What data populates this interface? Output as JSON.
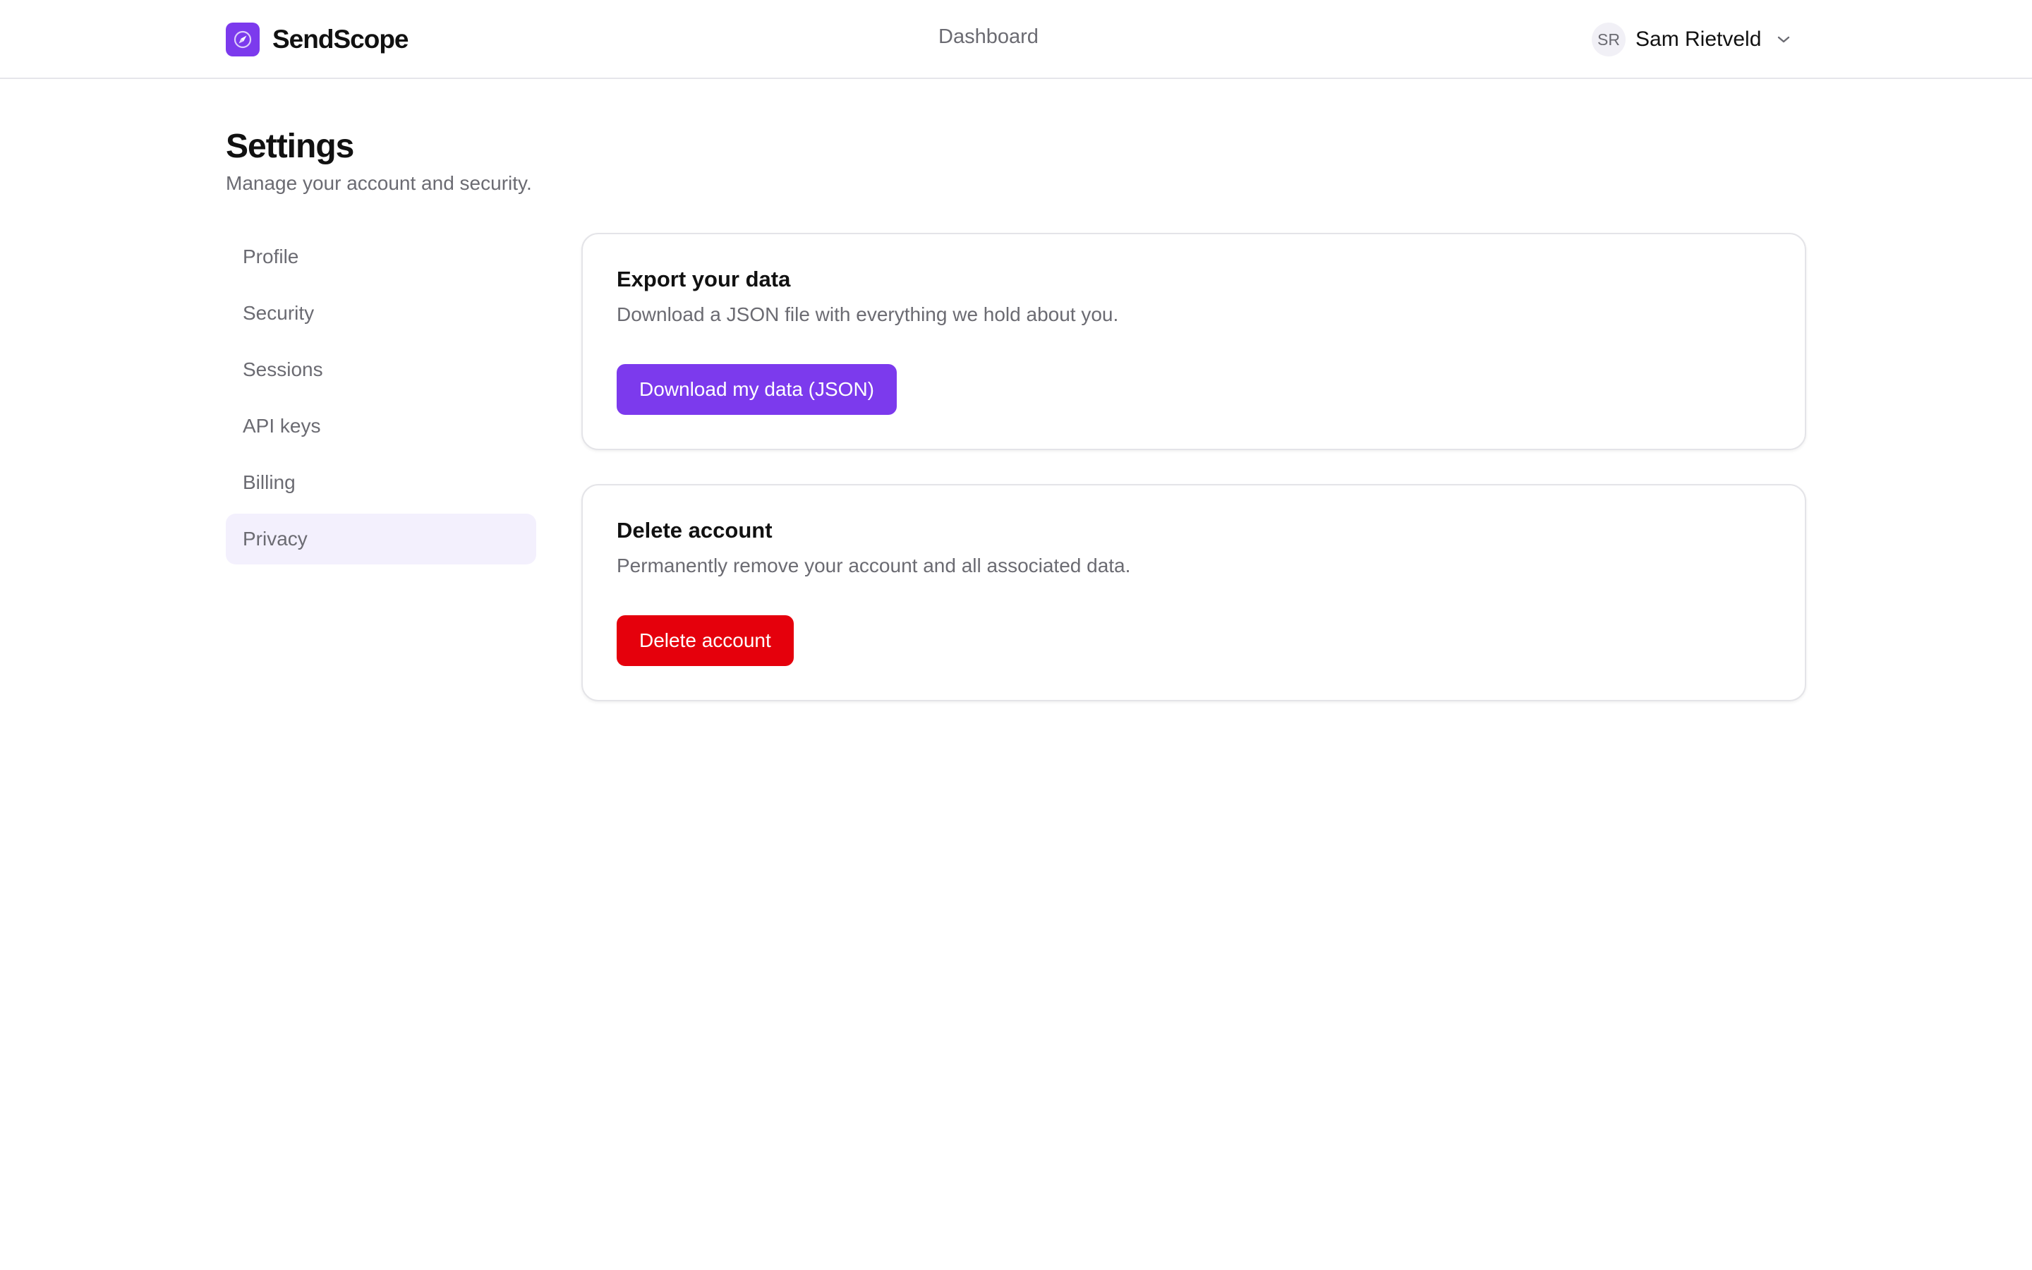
{
  "brand": {
    "name": "SendScope",
    "accent_color": "#7c3aed",
    "logo_icon": "compass-icon"
  },
  "header": {
    "nav_link": "Dashboard",
    "user": {
      "initials": "SR",
      "name": "Sam Rietveld",
      "menu_icon": "chevron-down-icon"
    }
  },
  "page": {
    "title": "Settings",
    "subtitle": "Manage your account and security."
  },
  "sidebar": {
    "items": [
      {
        "label": "Profile",
        "active": false
      },
      {
        "label": "Security",
        "active": false
      },
      {
        "label": "Sessions",
        "active": false
      },
      {
        "label": "API keys",
        "active": false
      },
      {
        "label": "Billing",
        "active": false
      },
      {
        "label": "Privacy",
        "active": true
      }
    ]
  },
  "export_card": {
    "title": "Export your data",
    "description": "Download a JSON file with everything we hold about you.",
    "button_label": "Download my data (JSON)",
    "button_color": "#7c3aed"
  },
  "delete_card": {
    "title": "Delete account",
    "description": "Permanently remove your account and all associated data.",
    "button_label": "Delete account",
    "button_color": "#e5000c"
  }
}
